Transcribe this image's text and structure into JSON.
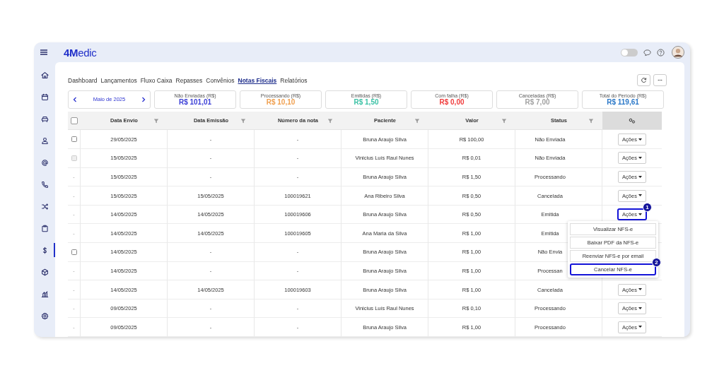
{
  "header": {
    "logo": "**4M**edic",
    "theme_toggle": {
      "on": false
    }
  },
  "sidebar": {
    "items": [
      {
        "kind": "home",
        "selected": false
      },
      {
        "kind": "calendar",
        "selected": false
      },
      {
        "kind": "car",
        "selected": false
      },
      {
        "kind": "person",
        "selected": false
      },
      {
        "kind": "at",
        "selected": false
      },
      {
        "kind": "phone",
        "selected": false
      },
      {
        "kind": "shuffle",
        "selected": false
      },
      {
        "kind": "clipboard",
        "selected": false
      },
      {
        "kind": "dollar",
        "selected": true
      },
      {
        "kind": "box",
        "selected": false
      },
      {
        "kind": "chart",
        "selected": false
      },
      {
        "kind": "gear",
        "selected": false
      }
    ]
  },
  "tabs": [
    {
      "label": "Dashboard",
      "selected": false
    },
    {
      "label": "Lançamentos",
      "selected": false
    },
    {
      "label": "Fluxo Caixa",
      "selected": false
    },
    {
      "label": "Repasses",
      "selected": false
    },
    {
      "label": "Convênios",
      "selected": false
    },
    {
      "label": "Notas Fiscais",
      "selected": true
    },
    {
      "label": "Relatórios",
      "selected": false
    }
  ],
  "period": "Maio de 2025",
  "summary": [
    {
      "label": "Não Enviadas (R$)",
      "value": "R$ 101,01",
      "color": "#3b3fd6"
    },
    {
      "label": "Processando (R$)",
      "value": "R$ 10,10",
      "color": "#f0a050"
    },
    {
      "label": "Emitidas (R$)",
      "value": "R$ 1,50",
      "color": "#3cc2a6"
    },
    {
      "label": "Com falha (R$)",
      "value": "R$ 0,00",
      "color": "#f03c3c"
    },
    {
      "label": "Canceladas (R$)",
      "value": "R$ 7,00",
      "color": "#a3a3a3"
    },
    {
      "label": "Total do Período (R$)",
      "value": "R$ 119,61",
      "color": "#2b78c8"
    }
  ],
  "table": {
    "select_all": {
      "checked": false
    },
    "columns": [
      "Data Envio",
      "Data Emissão",
      "Número da nota",
      "Paciente",
      "Valor",
      "Status"
    ],
    "rows": [
      {
        "select": {
          "kind": "checkbox",
          "disabled": false
        },
        "cells": [
          "29/05/2025",
          "-",
          "-",
          "Bruna Araujo Silva",
          "R$ 100,00",
          "Não Enviada"
        ],
        "action": {
          "label": "Ações",
          "highlighted": false
        }
      },
      {
        "select": {
          "kind": "checkbox",
          "disabled": true
        },
        "cells": [
          "15/05/2025",
          "-",
          "-",
          "Vinicius Luís Raul Nunes",
          "R$ 0,01",
          "Não Enviada"
        ],
        "action": {
          "label": "Ações",
          "highlighted": false
        }
      },
      {
        "select": {
          "kind": "text",
          "text": "-"
        },
        "cells": [
          "15/05/2025",
          "-",
          "-",
          "Bruna Araujo Silva",
          "R$ 1,50",
          "Processando"
        ],
        "action": {
          "label": "Ações",
          "highlighted": false
        }
      },
      {
        "select": {
          "kind": "text",
          "text": "-"
        },
        "cells": [
          "15/05/2025",
          "15/05/2025",
          "100019621",
          "Ana Ribeiro Silva",
          "R$ 0,50",
          "Cancelada"
        ],
        "action": {
          "label": "Ações",
          "highlighted": false
        }
      },
      {
        "select": {
          "kind": "text",
          "text": "-"
        },
        "cells": [
          "14/05/2025",
          "14/05/2025",
          "100019606",
          "Bruna Araujo Silva",
          "R$ 0,50",
          "Emitida"
        ],
        "action": {
          "label": "Ações",
          "highlighted": true,
          "badge": "1"
        },
        "menu": [
          {
            "label": "Visualizar NFS-e",
            "highlighted": false
          },
          {
            "label": "Baixar PDF da NFS-e",
            "highlighted": false
          },
          {
            "label": "Reenviar NFS-e por email",
            "highlighted": false
          },
          {
            "label": "Cancelar NFS-e",
            "highlighted": true,
            "badge": "2"
          }
        ]
      },
      {
        "select": {
          "kind": "text",
          "text": "-"
        },
        "cells": [
          "14/05/2025",
          "14/05/2025",
          "100019605",
          "Ana Maria da Silva",
          "R$ 1,00",
          "Emitida"
        ]
      },
      {
        "select": {
          "kind": "checkbox",
          "disabled": false
        },
        "cells": [
          "14/05/2025",
          "-",
          "-",
          "Bruna Araujo Silva",
          "R$ 1,00",
          "Não Envia"
        ]
      },
      {
        "select": {
          "kind": "text",
          "text": "-"
        },
        "cells": [
          "14/05/2025",
          "-",
          "-",
          "Bruna Araujo Silva",
          "R$ 1,00",
          "Processan"
        ]
      },
      {
        "select": {
          "kind": "text",
          "text": "-"
        },
        "cells": [
          "14/05/2025",
          "14/05/2025",
          "100019603",
          "Bruna Araujo Silva",
          "R$ 1,00",
          "Cancelada"
        ],
        "action": {
          "label": "Ações",
          "highlighted": false
        }
      },
      {
        "select": {
          "kind": "text",
          "text": "-"
        },
        "cells": [
          "09/05/2025",
          "-",
          "-",
          "Vinicius Luís Raul Nunes",
          "R$ 0,10",
          "Processando"
        ],
        "action": {
          "label": "Ações",
          "highlighted": false
        }
      },
      {
        "select": {
          "kind": "text",
          "text": "-"
        },
        "cells": [
          "09/05/2025",
          "-",
          "-",
          "Bruna Araujo Silva",
          "R$ 1,00",
          "Processando"
        ],
        "action": {
          "label": "Ações",
          "highlighted": false
        }
      }
    ]
  }
}
